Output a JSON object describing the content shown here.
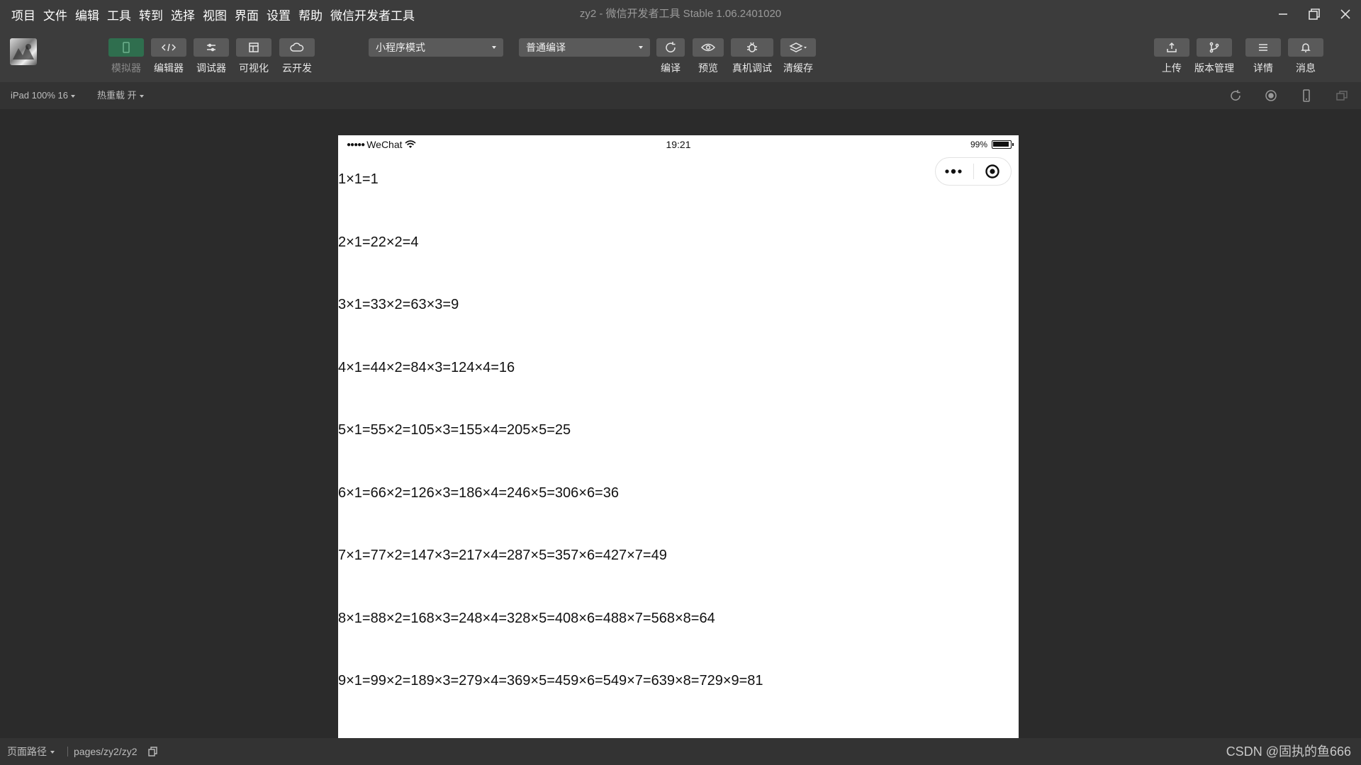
{
  "menu": [
    "项目",
    "文件",
    "编辑",
    "工具",
    "转到",
    "选择",
    "视图",
    "界面",
    "设置",
    "帮助",
    "微信开发者工具"
  ],
  "window_title": "zy2 - 微信开发者工具 Stable 1.06.2401020",
  "toolbar": {
    "simulator": "模拟器",
    "editor": "编辑器",
    "debugger": "调试器",
    "visual": "可视化",
    "cloud": "云开发",
    "mode_select": "小程序模式",
    "compile_select": "普通编译",
    "compile": "编译",
    "preview": "预览",
    "real_debug": "真机调试",
    "clear_cache": "清缓存",
    "upload": "上传",
    "version": "版本管理",
    "details": "详情",
    "messages": "消息"
  },
  "subbar": {
    "device": "iPad 100% 16",
    "hot_reload": "热重载 开"
  },
  "phone": {
    "carrier": "WeChat",
    "time": "19:21",
    "battery": "99%"
  },
  "content_rows": [
    "1×1=1",
    "2×1=22×2=4",
    "3×1=33×2=63×3=9",
    "4×1=44×2=84×3=124×4=16",
    "5×1=55×2=105×3=155×4=205×5=25",
    "6×1=66×2=126×3=186×4=246×5=306×6=36",
    "7×1=77×2=147×3=217×4=287×5=357×6=427×7=49",
    "8×1=88×2=168×3=248×4=328×5=408×6=488×7=568×8=64",
    "9×1=99×2=189×3=279×4=369×5=459×6=549×7=639×8=729×9=81"
  ],
  "bottombar": {
    "page_path_label": "页面路径",
    "page_path": "pages/zy2/zy2",
    "watermark": "CSDN @固执的鱼666"
  },
  "colors": {
    "active_tool": "#2f6e4e",
    "chrome": "#3c3c3c",
    "canvas": "#2b2b2b"
  }
}
